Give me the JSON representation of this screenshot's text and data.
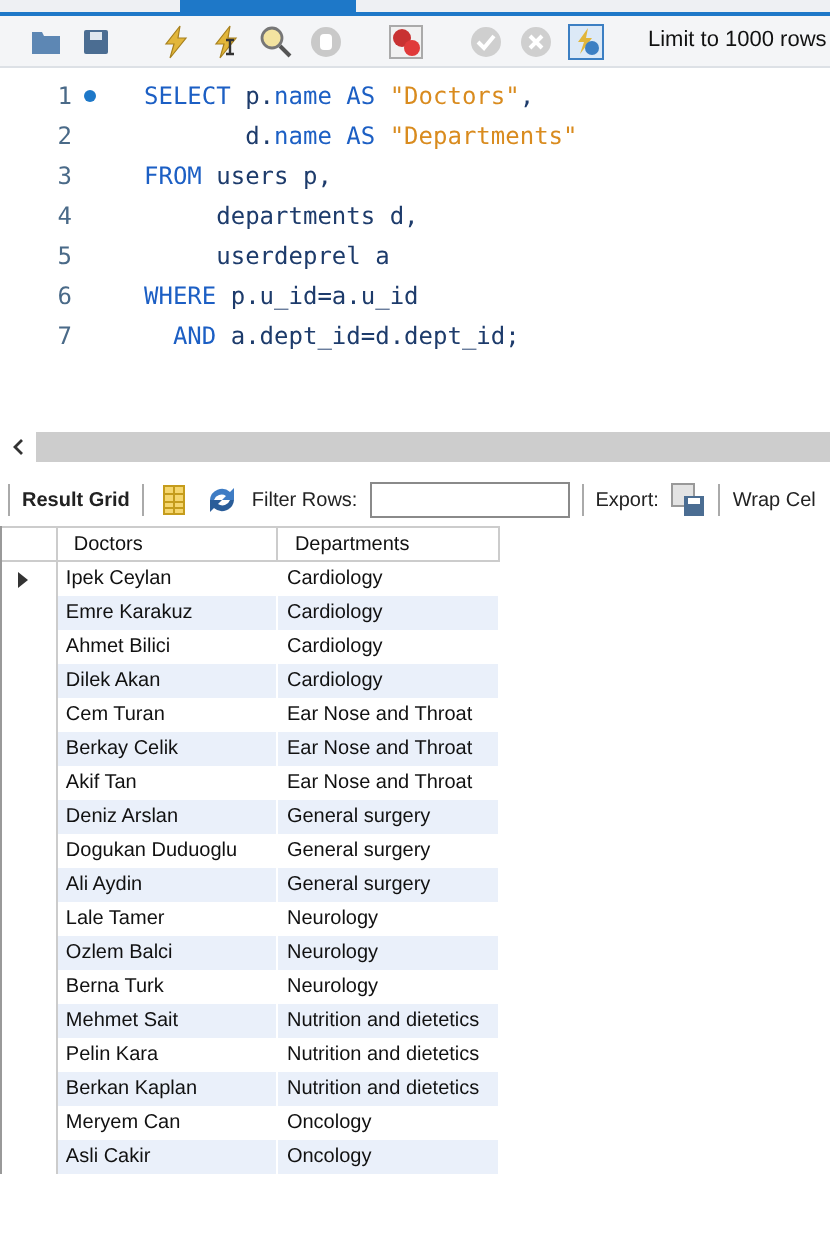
{
  "toolbar": {
    "limit": "Limit to 1000 rows"
  },
  "editor": {
    "lines": [
      {
        "number": "1",
        "marker": true,
        "tokens": [
          {
            "kind": "keyword",
            "text": "SELECT "
          },
          {
            "kind": "plain",
            "text": "p."
          },
          {
            "kind": "keyword",
            "text": "name AS "
          },
          {
            "kind": "string",
            "text": "\"Doctors\""
          },
          {
            "kind": "plain",
            "text": ","
          }
        ]
      },
      {
        "number": "2",
        "marker": false,
        "tokens": [
          {
            "kind": "plain",
            "text": "       d."
          },
          {
            "kind": "keyword",
            "text": "name AS "
          },
          {
            "kind": "string",
            "text": "\"Departments\""
          }
        ]
      },
      {
        "number": "3",
        "marker": false,
        "tokens": [
          {
            "kind": "keyword",
            "text": "FROM "
          },
          {
            "kind": "plain",
            "text": "users p,"
          }
        ]
      },
      {
        "number": "4",
        "marker": false,
        "tokens": [
          {
            "kind": "plain",
            "text": "     departments d,"
          }
        ]
      },
      {
        "number": "5",
        "marker": false,
        "tokens": [
          {
            "kind": "plain",
            "text": "     userdeprel a"
          }
        ]
      },
      {
        "number": "6",
        "marker": false,
        "tokens": [
          {
            "kind": "keyword",
            "text": "WHERE "
          },
          {
            "kind": "plain",
            "text": "p.u_id=a.u_id"
          }
        ]
      },
      {
        "number": "7",
        "marker": false,
        "tokens": [
          {
            "kind": "keyword",
            "text": "  AND "
          },
          {
            "kind": "plain",
            "text": "a.dept_id=d.dept_id;"
          }
        ]
      }
    ]
  },
  "result_toolbar": {
    "result_grid": "Result Grid",
    "filter_label": "Filter Rows:",
    "export_label": "Export:",
    "wrap_label": "Wrap Cel"
  },
  "table": {
    "columns": [
      "Doctors",
      "Departments"
    ],
    "rows": [
      {
        "selected": true,
        "cells": [
          "Ipek Ceylan",
          "Cardiology"
        ]
      },
      {
        "selected": false,
        "cells": [
          "Emre Karakuz",
          "Cardiology"
        ]
      },
      {
        "selected": false,
        "cells": [
          "Ahmet Bilici",
          "Cardiology"
        ]
      },
      {
        "selected": false,
        "cells": [
          "Dilek Akan",
          "Cardiology"
        ]
      },
      {
        "selected": false,
        "cells": [
          "Cem Turan",
          "Ear Nose and Throat"
        ]
      },
      {
        "selected": false,
        "cells": [
          "Berkay Celik",
          "Ear Nose and Throat"
        ]
      },
      {
        "selected": false,
        "cells": [
          "Akif Tan",
          "Ear Nose and Throat"
        ]
      },
      {
        "selected": false,
        "cells": [
          "Deniz Arslan",
          "General surgery"
        ]
      },
      {
        "selected": false,
        "cells": [
          "Dogukan Duduoglu",
          "General surgery"
        ]
      },
      {
        "selected": false,
        "cells": [
          "Ali Aydin",
          "General surgery"
        ]
      },
      {
        "selected": false,
        "cells": [
          "Lale Tamer",
          "Neurology"
        ]
      },
      {
        "selected": false,
        "cells": [
          "Ozlem Balci",
          "Neurology"
        ]
      },
      {
        "selected": false,
        "cells": [
          "Berna Turk",
          "Neurology"
        ]
      },
      {
        "selected": false,
        "cells": [
          "Mehmet Sait",
          "Nutrition and dietetics"
        ]
      },
      {
        "selected": false,
        "cells": [
          "Pelin Kara",
          "Nutrition and dietetics"
        ]
      },
      {
        "selected": false,
        "cells": [
          "Berkan Kaplan",
          "Nutrition and dietetics"
        ]
      },
      {
        "selected": false,
        "cells": [
          "Meryem Can",
          "Oncology"
        ]
      },
      {
        "selected": false,
        "cells": [
          "Asli Cakir",
          "Oncology"
        ]
      }
    ]
  }
}
